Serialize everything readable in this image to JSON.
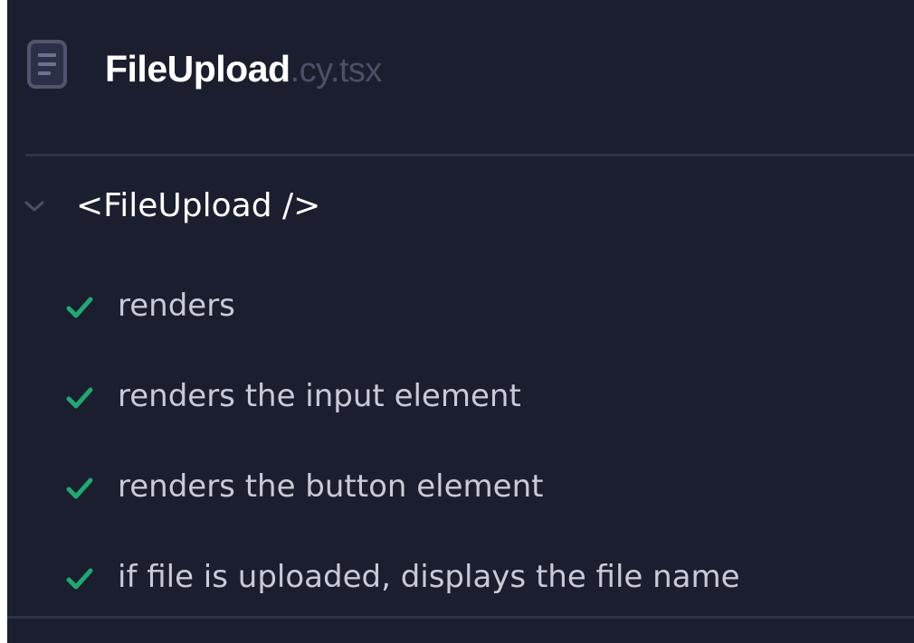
{
  "spec": {
    "file_base": "FileUpload",
    "file_ext": ".cy.tsx",
    "icon": "document-icon"
  },
  "suite": {
    "title": "<FileUpload />",
    "icon": "chevron-down-icon",
    "expanded": true
  },
  "tests": [
    {
      "label": "renders",
      "status": "passed",
      "icon": "check-icon"
    },
    {
      "label": "renders the input element",
      "status": "passed",
      "icon": "check-icon"
    },
    {
      "label": "renders the button element",
      "status": "passed",
      "icon": "check-icon"
    },
    {
      "label": "if file is uploaded, displays the file name",
      "status": "passed",
      "icon": "check-icon"
    }
  ],
  "colors": {
    "background": "#1b1e2e",
    "pass": "#1fa971",
    "divider": "#2e3245",
    "extension": "#4a5068"
  }
}
